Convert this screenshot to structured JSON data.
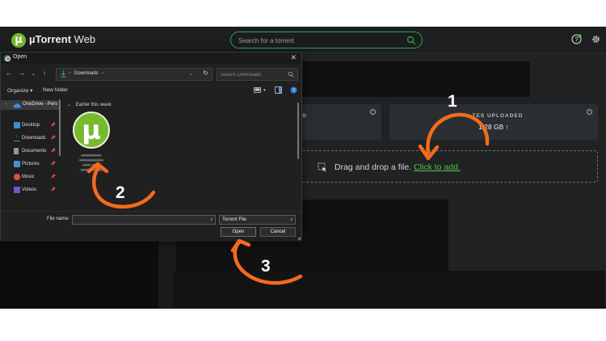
{
  "app": {
    "brand_main": "µTorrent",
    "brand_sub": "Web",
    "search_placeholder": "Search for a torrent",
    "stats": {
      "downloaded_title": "D",
      "uploaded_title": "BYTES UPLOADED",
      "uploaded_title_visible": "TES UPLOADED",
      "uploaded_value": "1.28 GB ↑"
    },
    "drop_zone": {
      "text": "Drag and drop a file.",
      "link": "Click to add."
    },
    "colors": {
      "accent": "#55c24a",
      "logo": "#76b82a",
      "annotation": "#f26b1d"
    }
  },
  "dialog": {
    "title": "Open",
    "close_glyph": "✕",
    "address": "Downloads",
    "search_placeholder": "Search Downloads",
    "organize_label": "Organize ▾",
    "new_folder_label": "New folder",
    "sidebar": {
      "onedrive": "OneDrive - Pers",
      "items": [
        {
          "label": "Desktop",
          "icon": "desktop-icon",
          "color": "#3d8bd9"
        },
        {
          "label": "Downloads",
          "icon": "download-icon",
          "color": "#35a56a"
        },
        {
          "label": "Documents",
          "icon": "documents-icon",
          "color": "#8a9bb0"
        },
        {
          "label": "Pictures",
          "icon": "pictures-icon",
          "color": "#4b8fd6"
        },
        {
          "label": "Music",
          "icon": "music-icon",
          "color": "#d9523e"
        },
        {
          "label": "Videos",
          "icon": "videos-icon",
          "color": "#7b4fd0"
        }
      ]
    },
    "group_header": "Earlier this week",
    "file_icon_glyph": "µ",
    "file_name_label": "File name:",
    "file_name_value": "",
    "file_type": "Torrent File",
    "open_label": "Open",
    "cancel_label": "Cancel"
  },
  "annotations": {
    "steps": [
      "1",
      "2",
      "3"
    ]
  }
}
